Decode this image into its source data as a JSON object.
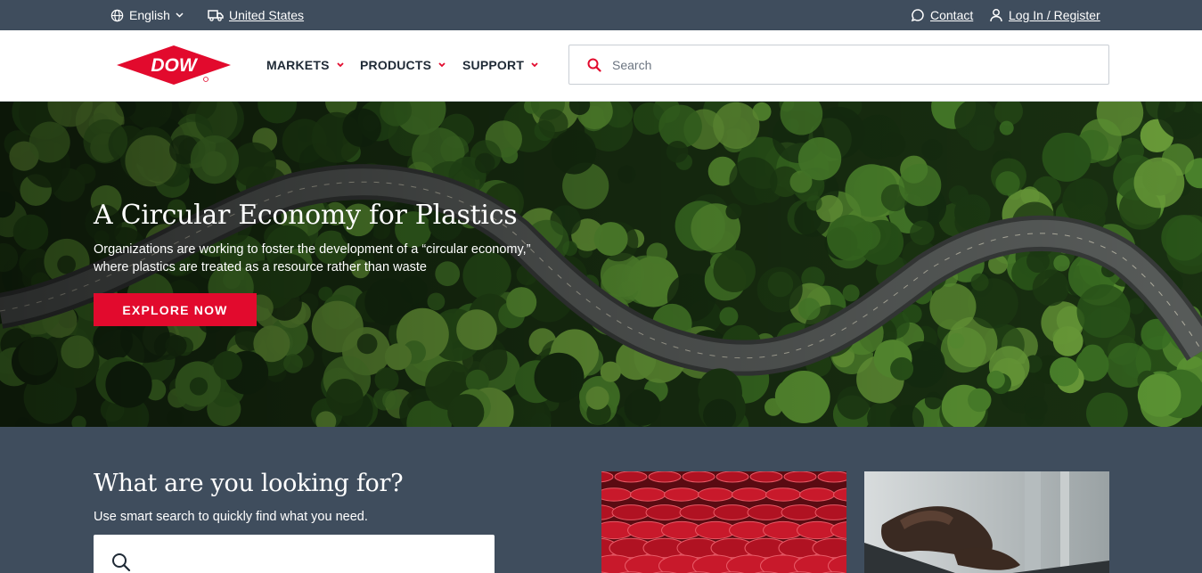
{
  "utility": {
    "language": "English",
    "region": "United States",
    "contact": "Contact",
    "login": "Log In / Register"
  },
  "header": {
    "logo_text": "DOW",
    "nav": [
      {
        "label": "MARKETS"
      },
      {
        "label": "PRODUCTS"
      },
      {
        "label": "SUPPORT"
      }
    ],
    "search_placeholder": "Search"
  },
  "hero": {
    "title": "A Circular Economy for Plastics",
    "text_line1": "Organizations are working to foster the development of a “circular economy,”",
    "text_line2": "where plastics are treated as a resource rather than waste",
    "button": "EXPLORE NOW"
  },
  "lower": {
    "title": "What are you looking for?",
    "subtitle": "Use smart search to quickly find what you need."
  },
  "colors": {
    "brand_red": "#e20a2d",
    "slate": "#3f4d5d"
  }
}
